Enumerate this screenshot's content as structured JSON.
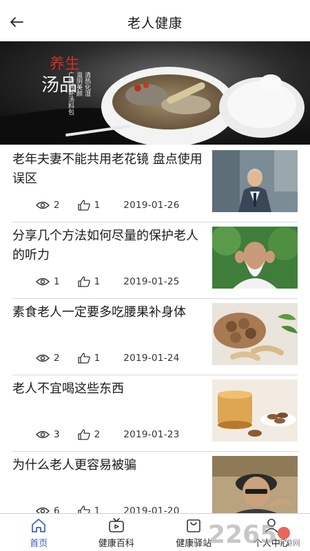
{
  "header": {
    "title": "老人健康"
  },
  "banner": {
    "title_line1": "养生",
    "title_line2": "汤品",
    "caption_col1": "清热化湿",
    "caption_col2": "滋阴美颜",
    "caption_col3": "广府清补汤料包"
  },
  "articles": [
    {
      "title": "老年夫妻不能共用老花镜 盘点使用误区",
      "views": "2",
      "likes": "1",
      "date": "2019-01-26"
    },
    {
      "title": "分享几个方法如何尽量的保护老人的听力",
      "views": "1",
      "likes": "1",
      "date": "2019-01-25"
    },
    {
      "title": "素食老人一定要多吃腰果补身体",
      "views": "2",
      "likes": "1",
      "date": "2019-01-24"
    },
    {
      "title": "老人不宜喝这些东西",
      "views": "3",
      "likes": "2",
      "date": "2019-01-23"
    },
    {
      "title": "为什么老人更容易被骗",
      "views": "6",
      "likes": "1",
      "date": "2019-01-20"
    }
  ],
  "tabs": [
    {
      "label": "首页",
      "active": true
    },
    {
      "label": "健康百科",
      "active": false
    },
    {
      "label": "健康驿站",
      "active": false
    },
    {
      "label": "个人中心",
      "active": false
    }
  ],
  "watermark": {
    "text": "2265",
    "sub": "手游网"
  },
  "colors": {
    "accent": "#3b5cc4",
    "text": "#1a1a1a",
    "divider": "#d8d8d8"
  }
}
